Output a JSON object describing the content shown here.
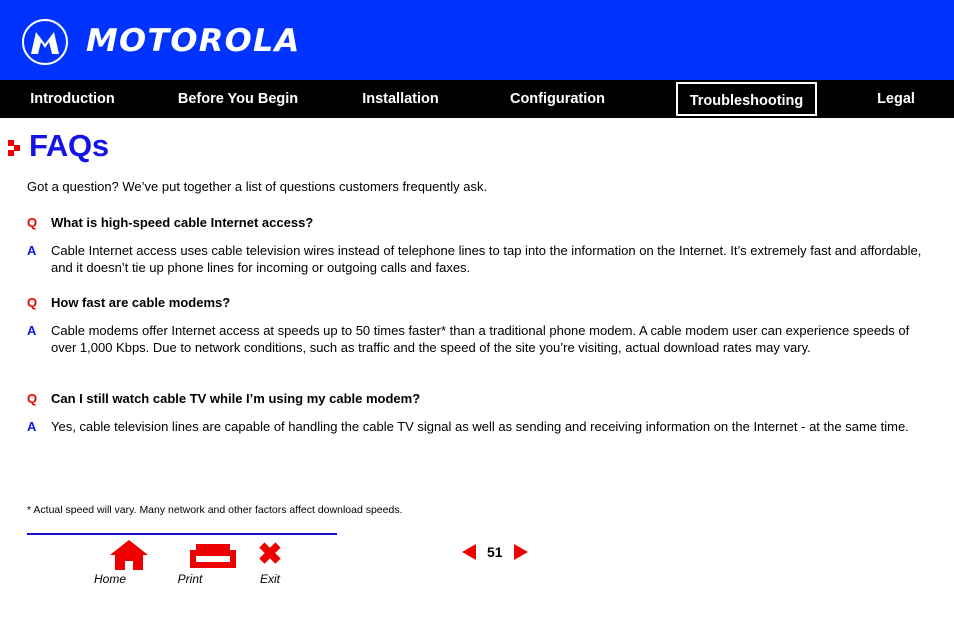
{
  "header": {
    "brand": "MOTOROLA",
    "logo_icon": "motorola-m-logo",
    "background_color": "#0033FF"
  },
  "nav": {
    "background_color": "#000000",
    "active_item": "Troubleshooting",
    "items": [
      {
        "label": "Introduction",
        "active": false
      },
      {
        "label": "Before You Begin",
        "active": false
      },
      {
        "label": "Installation",
        "active": false
      },
      {
        "label": "Configuration",
        "active": false
      },
      {
        "label": "Troubleshooting",
        "active": true
      },
      {
        "label": "Legal",
        "active": false
      }
    ]
  },
  "page": {
    "title": "FAQs",
    "title_color": "#1414E6",
    "bullet_icon": "red-arrow-bullet",
    "bullet_color": "#EE0000",
    "intro": "Got a question? We’ve put together a list of questions customers frequently ask."
  },
  "faqs": {
    "q_marker": "Q",
    "a_marker": "A",
    "q_color": "#EE0000",
    "a_color": "#1414E6",
    "items": [
      {
        "question": "What is high-speed cable Internet access?",
        "answer": "Cable Internet access uses cable television wires instead of telephone lines to tap into the information on the Internet. It’s extremely fast and affordable, and it doesn’t tie up phone lines for incoming or outgoing calls and faxes."
      },
      {
        "question": "How fast are cable modems?",
        "answer": "Cable modems offer Internet access at speeds up to 50 times faster* than a traditional phone modem. A cable modem user can experience speeds of over 1,000 Kbps. Due to network conditions, such as traffic and the speed of the site you’re visiting, actual download rates may vary."
      },
      {
        "question": "Can I still watch cable TV while I’m using my cable modem?",
        "answer": "Yes, cable television lines are capable of handling the cable TV signal as well as sending and receiving information on the Internet - at the same time."
      }
    ]
  },
  "footnote": "* Actual speed will vary. Many network and other factors affect download speeds.",
  "footer": {
    "rule_color": "#1414C8",
    "buttons": [
      {
        "label": "Home",
        "icon": "home-icon"
      },
      {
        "label": "Print",
        "icon": "printer-icon"
      },
      {
        "label": "Exit",
        "icon": "close-x-icon"
      }
    ],
    "pager": {
      "prev_icon": "triangle-left-icon",
      "next_icon": "triangle-right-icon",
      "page_number": "51",
      "arrow_color": "#EE0000"
    }
  }
}
